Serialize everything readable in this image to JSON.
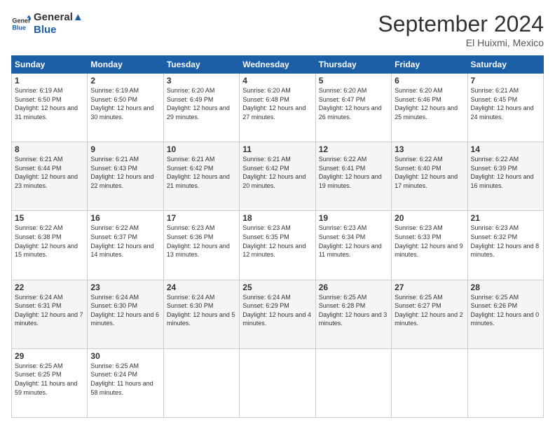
{
  "logo": {
    "line1": "General",
    "line2": "Blue"
  },
  "title": "September 2024",
  "location": "El Huixmi, Mexico",
  "days_header": [
    "Sunday",
    "Monday",
    "Tuesday",
    "Wednesday",
    "Thursday",
    "Friday",
    "Saturday"
  ],
  "weeks": [
    [
      {
        "day": "1",
        "sunrise": "6:19 AM",
        "sunset": "6:50 PM",
        "daylight": "12 hours and 31 minutes."
      },
      {
        "day": "2",
        "sunrise": "6:19 AM",
        "sunset": "6:50 PM",
        "daylight": "12 hours and 30 minutes."
      },
      {
        "day": "3",
        "sunrise": "6:20 AM",
        "sunset": "6:49 PM",
        "daylight": "12 hours and 29 minutes."
      },
      {
        "day": "4",
        "sunrise": "6:20 AM",
        "sunset": "6:48 PM",
        "daylight": "12 hours and 27 minutes."
      },
      {
        "day": "5",
        "sunrise": "6:20 AM",
        "sunset": "6:47 PM",
        "daylight": "12 hours and 26 minutes."
      },
      {
        "day": "6",
        "sunrise": "6:20 AM",
        "sunset": "6:46 PM",
        "daylight": "12 hours and 25 minutes."
      },
      {
        "day": "7",
        "sunrise": "6:21 AM",
        "sunset": "6:45 PM",
        "daylight": "12 hours and 24 minutes."
      }
    ],
    [
      {
        "day": "8",
        "sunrise": "6:21 AM",
        "sunset": "6:44 PM",
        "daylight": "12 hours and 23 minutes."
      },
      {
        "day": "9",
        "sunrise": "6:21 AM",
        "sunset": "6:43 PM",
        "daylight": "12 hours and 22 minutes."
      },
      {
        "day": "10",
        "sunrise": "6:21 AM",
        "sunset": "6:42 PM",
        "daylight": "12 hours and 21 minutes."
      },
      {
        "day": "11",
        "sunrise": "6:21 AM",
        "sunset": "6:42 PM",
        "daylight": "12 hours and 20 minutes."
      },
      {
        "day": "12",
        "sunrise": "6:22 AM",
        "sunset": "6:41 PM",
        "daylight": "12 hours and 19 minutes."
      },
      {
        "day": "13",
        "sunrise": "6:22 AM",
        "sunset": "6:40 PM",
        "daylight": "12 hours and 17 minutes."
      },
      {
        "day": "14",
        "sunrise": "6:22 AM",
        "sunset": "6:39 PM",
        "daylight": "12 hours and 16 minutes."
      }
    ],
    [
      {
        "day": "15",
        "sunrise": "6:22 AM",
        "sunset": "6:38 PM",
        "daylight": "12 hours and 15 minutes."
      },
      {
        "day": "16",
        "sunrise": "6:22 AM",
        "sunset": "6:37 PM",
        "daylight": "12 hours and 14 minutes."
      },
      {
        "day": "17",
        "sunrise": "6:23 AM",
        "sunset": "6:36 PM",
        "daylight": "12 hours and 13 minutes."
      },
      {
        "day": "18",
        "sunrise": "6:23 AM",
        "sunset": "6:35 PM",
        "daylight": "12 hours and 12 minutes."
      },
      {
        "day": "19",
        "sunrise": "6:23 AM",
        "sunset": "6:34 PM",
        "daylight": "12 hours and 11 minutes."
      },
      {
        "day": "20",
        "sunrise": "6:23 AM",
        "sunset": "6:33 PM",
        "daylight": "12 hours and 9 minutes."
      },
      {
        "day": "21",
        "sunrise": "6:23 AM",
        "sunset": "6:32 PM",
        "daylight": "12 hours and 8 minutes."
      }
    ],
    [
      {
        "day": "22",
        "sunrise": "6:24 AM",
        "sunset": "6:31 PM",
        "daylight": "12 hours and 7 minutes."
      },
      {
        "day": "23",
        "sunrise": "6:24 AM",
        "sunset": "6:30 PM",
        "daylight": "12 hours and 6 minutes."
      },
      {
        "day": "24",
        "sunrise": "6:24 AM",
        "sunset": "6:30 PM",
        "daylight": "12 hours and 5 minutes."
      },
      {
        "day": "25",
        "sunrise": "6:24 AM",
        "sunset": "6:29 PM",
        "daylight": "12 hours and 4 minutes."
      },
      {
        "day": "26",
        "sunrise": "6:25 AM",
        "sunset": "6:28 PM",
        "daylight": "12 hours and 3 minutes."
      },
      {
        "day": "27",
        "sunrise": "6:25 AM",
        "sunset": "6:27 PM",
        "daylight": "12 hours and 2 minutes."
      },
      {
        "day": "28",
        "sunrise": "6:25 AM",
        "sunset": "6:26 PM",
        "daylight": "12 hours and 0 minutes."
      }
    ],
    [
      {
        "day": "29",
        "sunrise": "6:25 AM",
        "sunset": "6:25 PM",
        "daylight": "11 hours and 59 minutes."
      },
      {
        "day": "30",
        "sunrise": "6:25 AM",
        "sunset": "6:24 PM",
        "daylight": "11 hours and 58 minutes."
      },
      null,
      null,
      null,
      null,
      null
    ]
  ],
  "labels": {
    "sunrise": "Sunrise: ",
    "sunset": "Sunset: ",
    "daylight": "Daylight: "
  }
}
